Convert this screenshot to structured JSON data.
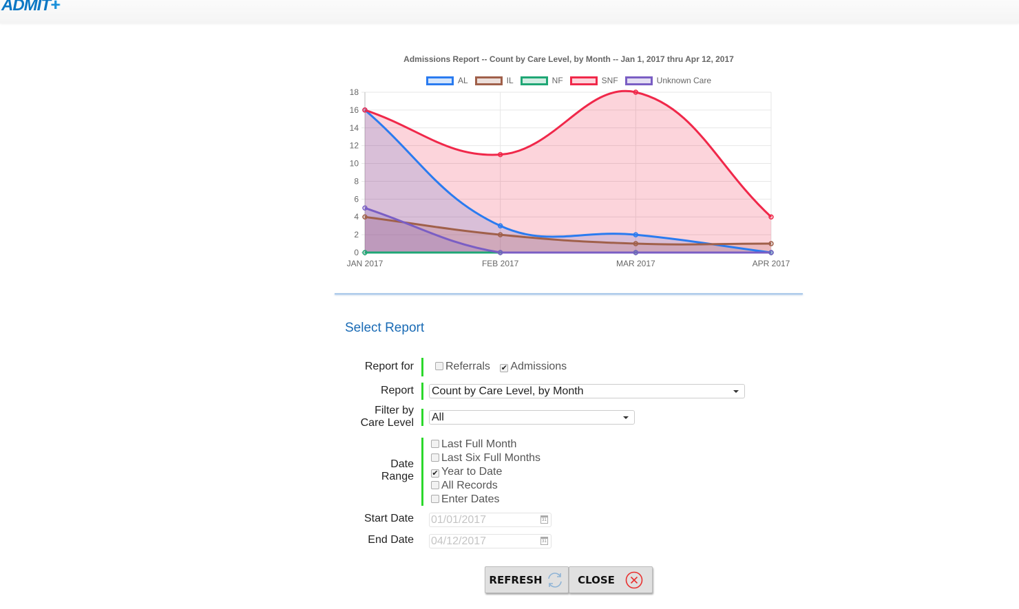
{
  "app": {
    "logo_text": "ADMIT",
    "logo_plus": "+"
  },
  "chart_data": {
    "type": "line",
    "title": "Admissions Report -- Count by Care Level, by Month -- Jan 1, 2017 thru Apr 12, 2017",
    "categories": [
      "JAN 2017",
      "FEB 2017",
      "MAR 2017",
      "APR 2017"
    ],
    "ylim": [
      0,
      18
    ],
    "yticks": [
      0,
      2,
      4,
      6,
      8,
      10,
      12,
      14,
      16,
      18
    ],
    "grid": true,
    "legend_position": "top",
    "filled": true,
    "series": [
      {
        "name": "AL",
        "values": [
          16,
          3,
          2,
          0
        ],
        "color": "#2a7bf0",
        "fill": "rgba(42,123,240,0.2)"
      },
      {
        "name": "IL",
        "values": [
          4,
          2,
          1,
          1
        ],
        "color": "#a0604a",
        "fill": "rgba(160,96,74,0.2)"
      },
      {
        "name": "NF",
        "values": [
          0,
          0,
          0,
          0
        ],
        "color": "#1fa775",
        "fill": "rgba(31,167,117,0.2)"
      },
      {
        "name": "SNF",
        "values": [
          16,
          11,
          18,
          4
        ],
        "color": "#f0284a",
        "fill": "rgba(240,40,74,0.2)"
      },
      {
        "name": "Unknown Care",
        "values": [
          5,
          0,
          0,
          0
        ],
        "color": "#7a5ec4",
        "fill": "rgba(122,94,196,0.2)"
      }
    ]
  },
  "form": {
    "section_title": "Select Report",
    "report_for": {
      "label": "Report for",
      "options": [
        {
          "label": "Referrals",
          "checked": false
        },
        {
          "label": "Admissions",
          "checked": true
        }
      ]
    },
    "report": {
      "label": "Report",
      "value": "Count by Care Level, by Month"
    },
    "filter": {
      "label_line1": "Filter by",
      "label_line2": "Care Level",
      "value": "All"
    },
    "date_range": {
      "label_line1": "Date",
      "label_line2": "Range",
      "options": [
        {
          "label": "Last Full Month",
          "checked": false
        },
        {
          "label": "Last Six Full Months",
          "checked": false
        },
        {
          "label": "Year to Date",
          "checked": true
        },
        {
          "label": "All Records",
          "checked": false
        },
        {
          "label": "Enter Dates",
          "checked": false
        }
      ]
    },
    "start_date": {
      "label": "Start Date",
      "value": "01/01/2017"
    },
    "end_date": {
      "label": "End Date",
      "value": "04/12/2017"
    },
    "calendar_icon_text": "31"
  },
  "buttons": {
    "refresh": "REFRESH",
    "close": "CLOSE"
  }
}
